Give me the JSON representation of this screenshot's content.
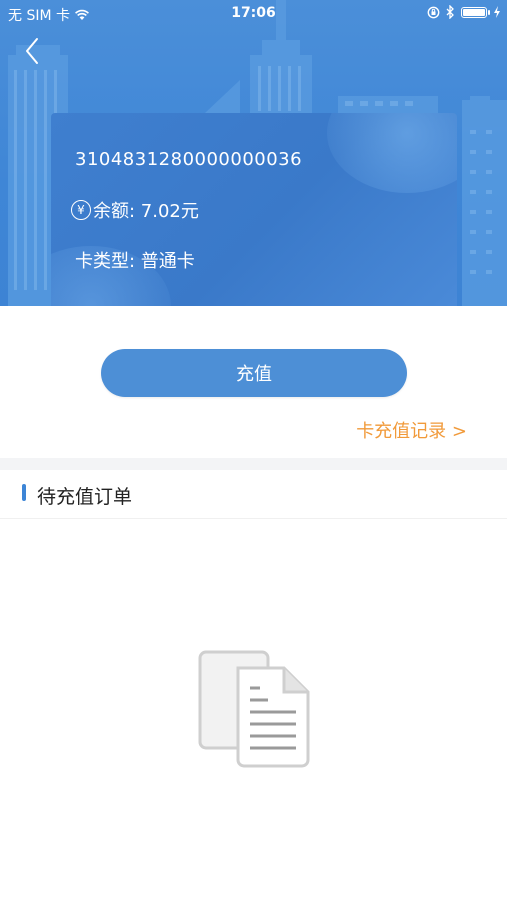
{
  "status_bar": {
    "carrier": "无 SIM 卡",
    "time": "17:06",
    "wifi_icon": "wifi-icon",
    "lock_icon": "orientation-lock-icon",
    "bluetooth_icon": "bluetooth-icon",
    "battery_icon": "battery-icon",
    "charging_icon": "charging-icon"
  },
  "header": {
    "back_icon": "chevron-left-icon"
  },
  "card": {
    "number": "3104831280000000036",
    "balance_symbol": "¥",
    "balance_text": "余额:  7.02元",
    "type_text": "卡类型:  普通卡"
  },
  "actions": {
    "recharge_label": "充值",
    "records_link": "卡充值记录 >"
  },
  "pending": {
    "title": "待充值订单",
    "empty_icon": "empty-documents-icon"
  },
  "colors": {
    "primary": "#4d8fd6",
    "hero_bg": "#4589d7",
    "link": "#f19a3a",
    "section_bar": "#3d85d6"
  }
}
